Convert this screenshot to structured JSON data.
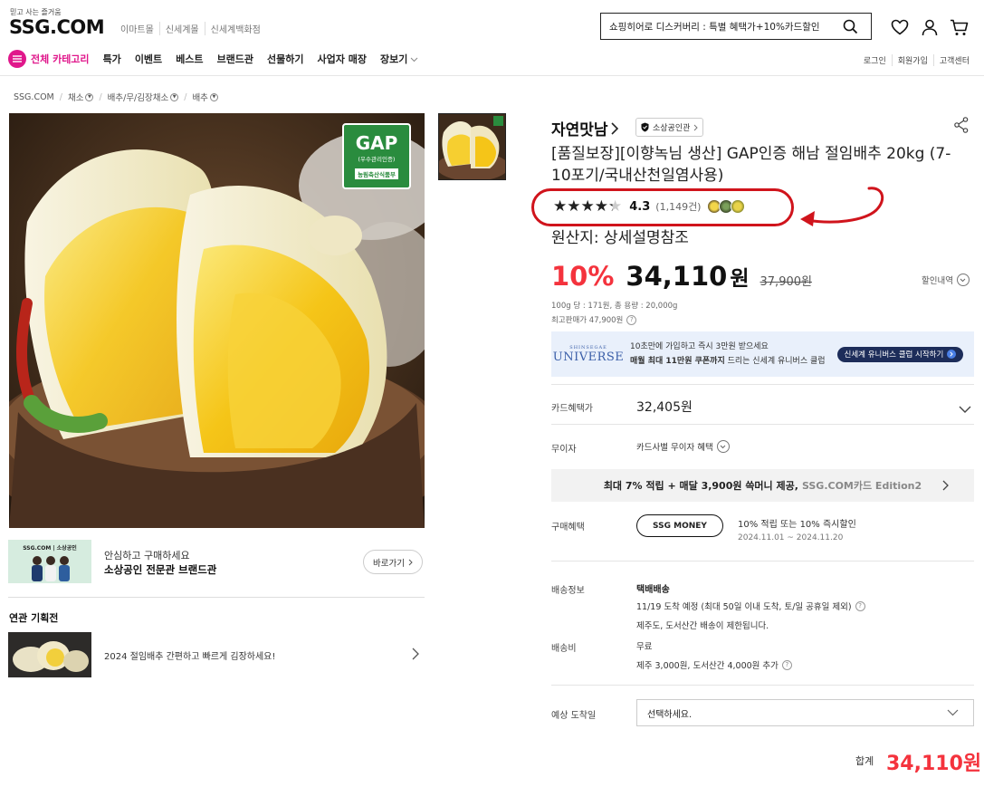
{
  "header": {
    "tagline": "믿고 사는 즐거움",
    "logo": "SSG.COM",
    "mall_links": [
      "이마트몰",
      "신세계몰",
      "신세계백화점"
    ],
    "search_value": "쇼핑히어로 디스커버리 : 특별 혜택가+10%카드할인"
  },
  "nav": {
    "all_category": "전체 카테고리",
    "items": [
      "특가",
      "이벤트",
      "베스트",
      "브랜드관",
      "선물하기",
      "사업자 매장",
      "장보기"
    ],
    "util": [
      "로그인",
      "회원가입",
      "고객센터"
    ]
  },
  "breadcrumb": [
    "SSG.COM",
    "채소",
    "배추/무/김장채소",
    "배추"
  ],
  "left": {
    "gap_badge": {
      "title": "GAP",
      "sub": "(우수관리인증)",
      "org": "농림축산식품부"
    },
    "banner_logo": "SSG.COM | 소상공인",
    "banner_line1": "안심하고 구매하세요",
    "banner_line2": "소상공인 전문관 브랜드관",
    "go_button": "바로가기",
    "related_title": "연관 기획전",
    "related_item": "2024 절임배추 간편하고 빠르게 김장하세요!"
  },
  "product": {
    "brand": "자연맛남",
    "brand_badge": "소상공인관",
    "title": "[품질보장][이향녹님 생산] GAP인증 해남 절임배추 20kg (7-10포기/국내산천일염사용)",
    "rating": "4.3",
    "rating_value": 4.3,
    "review_count": "(1,149건)",
    "origin": "원산지: 상세설명참조",
    "discount": "10%",
    "price": "34,110",
    "price_unit": "원",
    "original_price": "37,900원",
    "discount_detail": "할인내역",
    "unit_price": "100g 당 : 171원, 총 용량 : 20,000g",
    "max_price": "최고판매가 47,900원"
  },
  "universe": {
    "logo_top": "SHINSEGAE",
    "logo": "UNIVERSE",
    "line1": "10초만에 가입하고 즉시 3만원 받으세요",
    "line2_bold": "매월 최대 11만원 쿠폰까지",
    "line2_rest": " 드리는 신세계 유니버스 클럽",
    "button": "신세계 유니버스 클럽 시작하기"
  },
  "benefits": {
    "card_label": "카드혜택가",
    "card_price": "32,405원",
    "noint_label": "무이자",
    "noint_value": "카드사별 무이자 혜택",
    "ssg_card_bold": "최대 7% 적립 + 매달 3,900원 쓱머니 제공,",
    "ssg_card_gray": "SSG.COM카드 Edition2",
    "buy_label": "구매혜택",
    "ssg_money": "SSG MONEY",
    "benefit_line1": "10% 적립 또는 10% 즉시할인",
    "benefit_line2": "2024.11.01 ~ 2024.11.20"
  },
  "shipping": {
    "label": "배송정보",
    "type": "택배배송",
    "line1": "11/19 도착 예정  (최대 50일 이내 도착, 토/일 공휴일 제외)",
    "line2": "제주도, 도서산간 배송이 제한됩니다.",
    "fee_label": "배송비",
    "fee": "무료",
    "fee_extra": "제주  3,000원, 도서산간  4,000원 추가",
    "arrival_label": "예상 도착일",
    "arrival_select": "선택하세요."
  },
  "total": {
    "label": "합계",
    "price": "34,110원"
  },
  "colors": {
    "accent": "#f4333d",
    "brand_pink": "#e0178b",
    "highlight": "#d0141c"
  }
}
